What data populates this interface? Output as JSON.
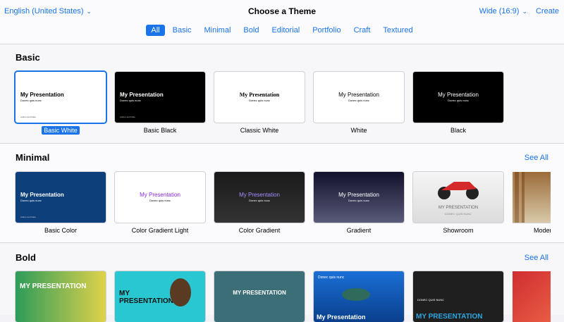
{
  "topbar": {
    "language": "English (United States)",
    "title": "Choose a Theme",
    "aspect": "Wide (16:9)",
    "create": "Create"
  },
  "tabs": [
    "All",
    "Basic",
    "Minimal",
    "Bold",
    "Editorial",
    "Portfolio",
    "Craft",
    "Textured"
  ],
  "sections": {
    "basic": {
      "title": "Basic",
      "themes": [
        "Basic White",
        "Basic Black",
        "Classic White",
        "White",
        "Black"
      ]
    },
    "minimal": {
      "title": "Minimal",
      "see_all": "See All",
      "themes": [
        "Basic Color",
        "Color Gradient Light",
        "Color Gradient",
        "Gradient",
        "Showroom",
        "Modern"
      ]
    },
    "bold": {
      "title": "Bold",
      "see_all": "See All"
    }
  },
  "thumb_text": {
    "my_presentation": "My Presentation",
    "my_presentation_caps": "MY PRESENTATION",
    "subtitle": "Donec quis nunc",
    "subtitle_caps": "DONEC QUIS NUNC",
    "author": "Author and Date"
  },
  "colors": {
    "accent": "#1a73e8",
    "basic_color_bg": "#0d3f7a",
    "gradient_purple": "#8a2be2"
  }
}
